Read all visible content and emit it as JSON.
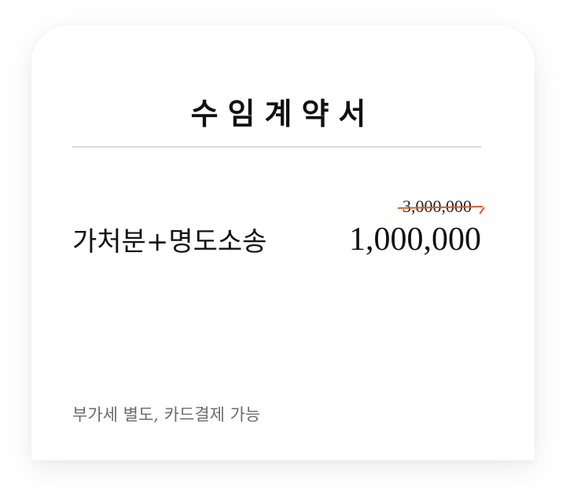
{
  "card": {
    "title": "수임계약서",
    "service_name": "가처분+명도소송",
    "original_price": "3,000,000",
    "sale_price": "1,000,000",
    "note": "부가세 별도, 카드결제 가능"
  },
  "colors": {
    "strike": "#e35b22",
    "note_text": "#6b6b6b",
    "divider": "#dadada"
  }
}
